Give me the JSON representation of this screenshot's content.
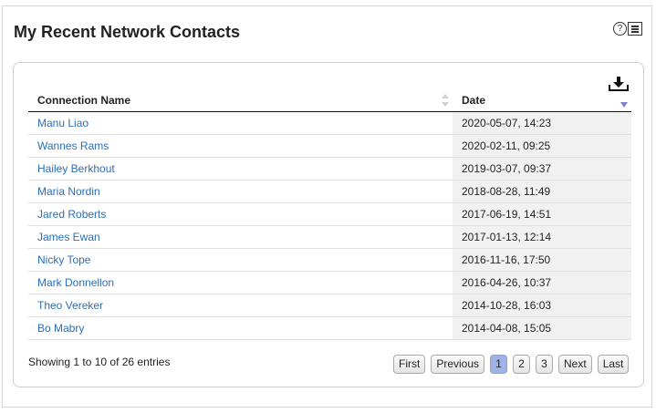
{
  "portlet": {
    "title": "My Recent Network Contacts",
    "help_glyph": "?"
  },
  "table": {
    "columns": [
      "Connection Name",
      "Date"
    ],
    "rows": [
      {
        "name": "Manu Liao",
        "date": "2020-05-07, 14:23"
      },
      {
        "name": "Wannes Rams",
        "date": "2020-02-11, 09:25"
      },
      {
        "name": "Hailey Berkhout",
        "date": "2019-03-07, 09:37"
      },
      {
        "name": "Maria Nordin",
        "date": "2018-08-28, 11:49"
      },
      {
        "name": "Jared Roberts",
        "date": "2017-06-19, 14:51"
      },
      {
        "name": "James Ewan",
        "date": "2017-01-13, 12:14"
      },
      {
        "name": "Nicky Tope",
        "date": "2016-11-16, 17:50"
      },
      {
        "name": "Mark Donnellon",
        "date": "2016-04-26, 10:37"
      },
      {
        "name": "Theo Vereker",
        "date": "2014-10-28, 16:03"
      },
      {
        "name": "Bo Mabry",
        "date": "2014-04-08, 15:05"
      }
    ],
    "sort_column": "Date",
    "sort_direction": "descending"
  },
  "footer": {
    "info": "Showing 1 to 10 of 26 entries",
    "pager": {
      "first": "First",
      "previous": "Previous",
      "pages": [
        "1",
        "2",
        "3"
      ],
      "current_page": "1",
      "next": "Next",
      "last": "Last"
    }
  },
  "colors": {
    "link": "#2a6ebb",
    "current_page": "#9fb3ea",
    "sorted_column_bg": "#f1f1f1"
  },
  "icons": [
    "help-icon",
    "menu-icon",
    "download-icon",
    "sort-both-icon",
    "sort-desc-icon"
  ]
}
